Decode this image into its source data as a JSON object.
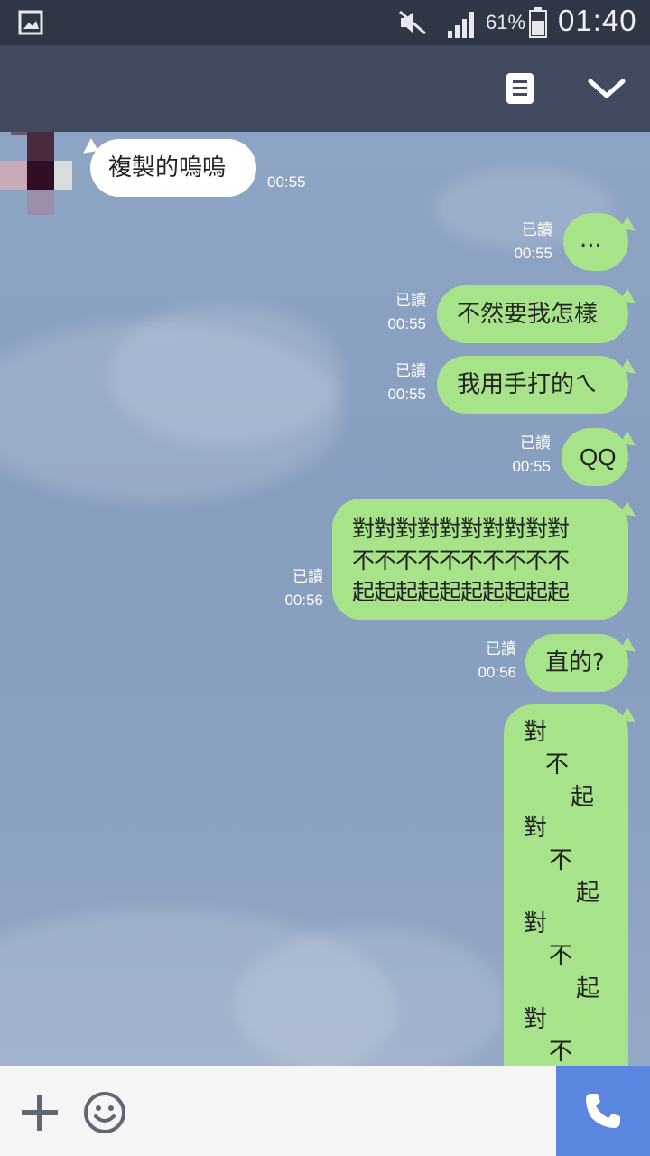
{
  "status_bar": {
    "battery_percent": "61%",
    "clock": "01:40",
    "icons": [
      "gallery-icon",
      "mute-icon",
      "signal-icon",
      "battery-icon"
    ]
  },
  "header": {
    "icons": [
      "notes-icon",
      "chevron-down-icon"
    ]
  },
  "messages": {
    "incoming_1": {
      "text": "複製的嗚嗚",
      "time": "00:55"
    },
    "out_1": {
      "text": "...",
      "read": "已讀",
      "time": "00:55"
    },
    "out_2": {
      "text": "不然要我怎樣",
      "read": "已讀",
      "time": "00:55"
    },
    "out_3": {
      "text": "我用手打的ㄟ",
      "read": "已讀",
      "time": "00:55"
    },
    "out_4": {
      "text": "QQ",
      "read": "已讀",
      "time": "00:55"
    },
    "out_5": {
      "line1": "對對對對對對對對對對",
      "line2": "不不不不不不不不不不",
      "line3": "起起起起起起起起起起",
      "read": "已讀",
      "time": "00:56"
    },
    "out_6": {
      "text": "直的?",
      "read": "已讀",
      "time": "00:56"
    },
    "out_7": {
      "chars": [
        "對",
        "不",
        "起",
        "對",
        "不",
        "起",
        "對",
        "不",
        "起",
        "對",
        "不"
      ]
    }
  },
  "bottom_bar": {
    "icons": [
      "plus-icon",
      "emoji-icon",
      "phone-icon"
    ]
  },
  "colors": {
    "status_bar": "#2f3747",
    "header": "#424a5f",
    "bubble_out": "#a6e389",
    "bubble_in": "#ffffff",
    "call_button": "#5b86e0"
  }
}
